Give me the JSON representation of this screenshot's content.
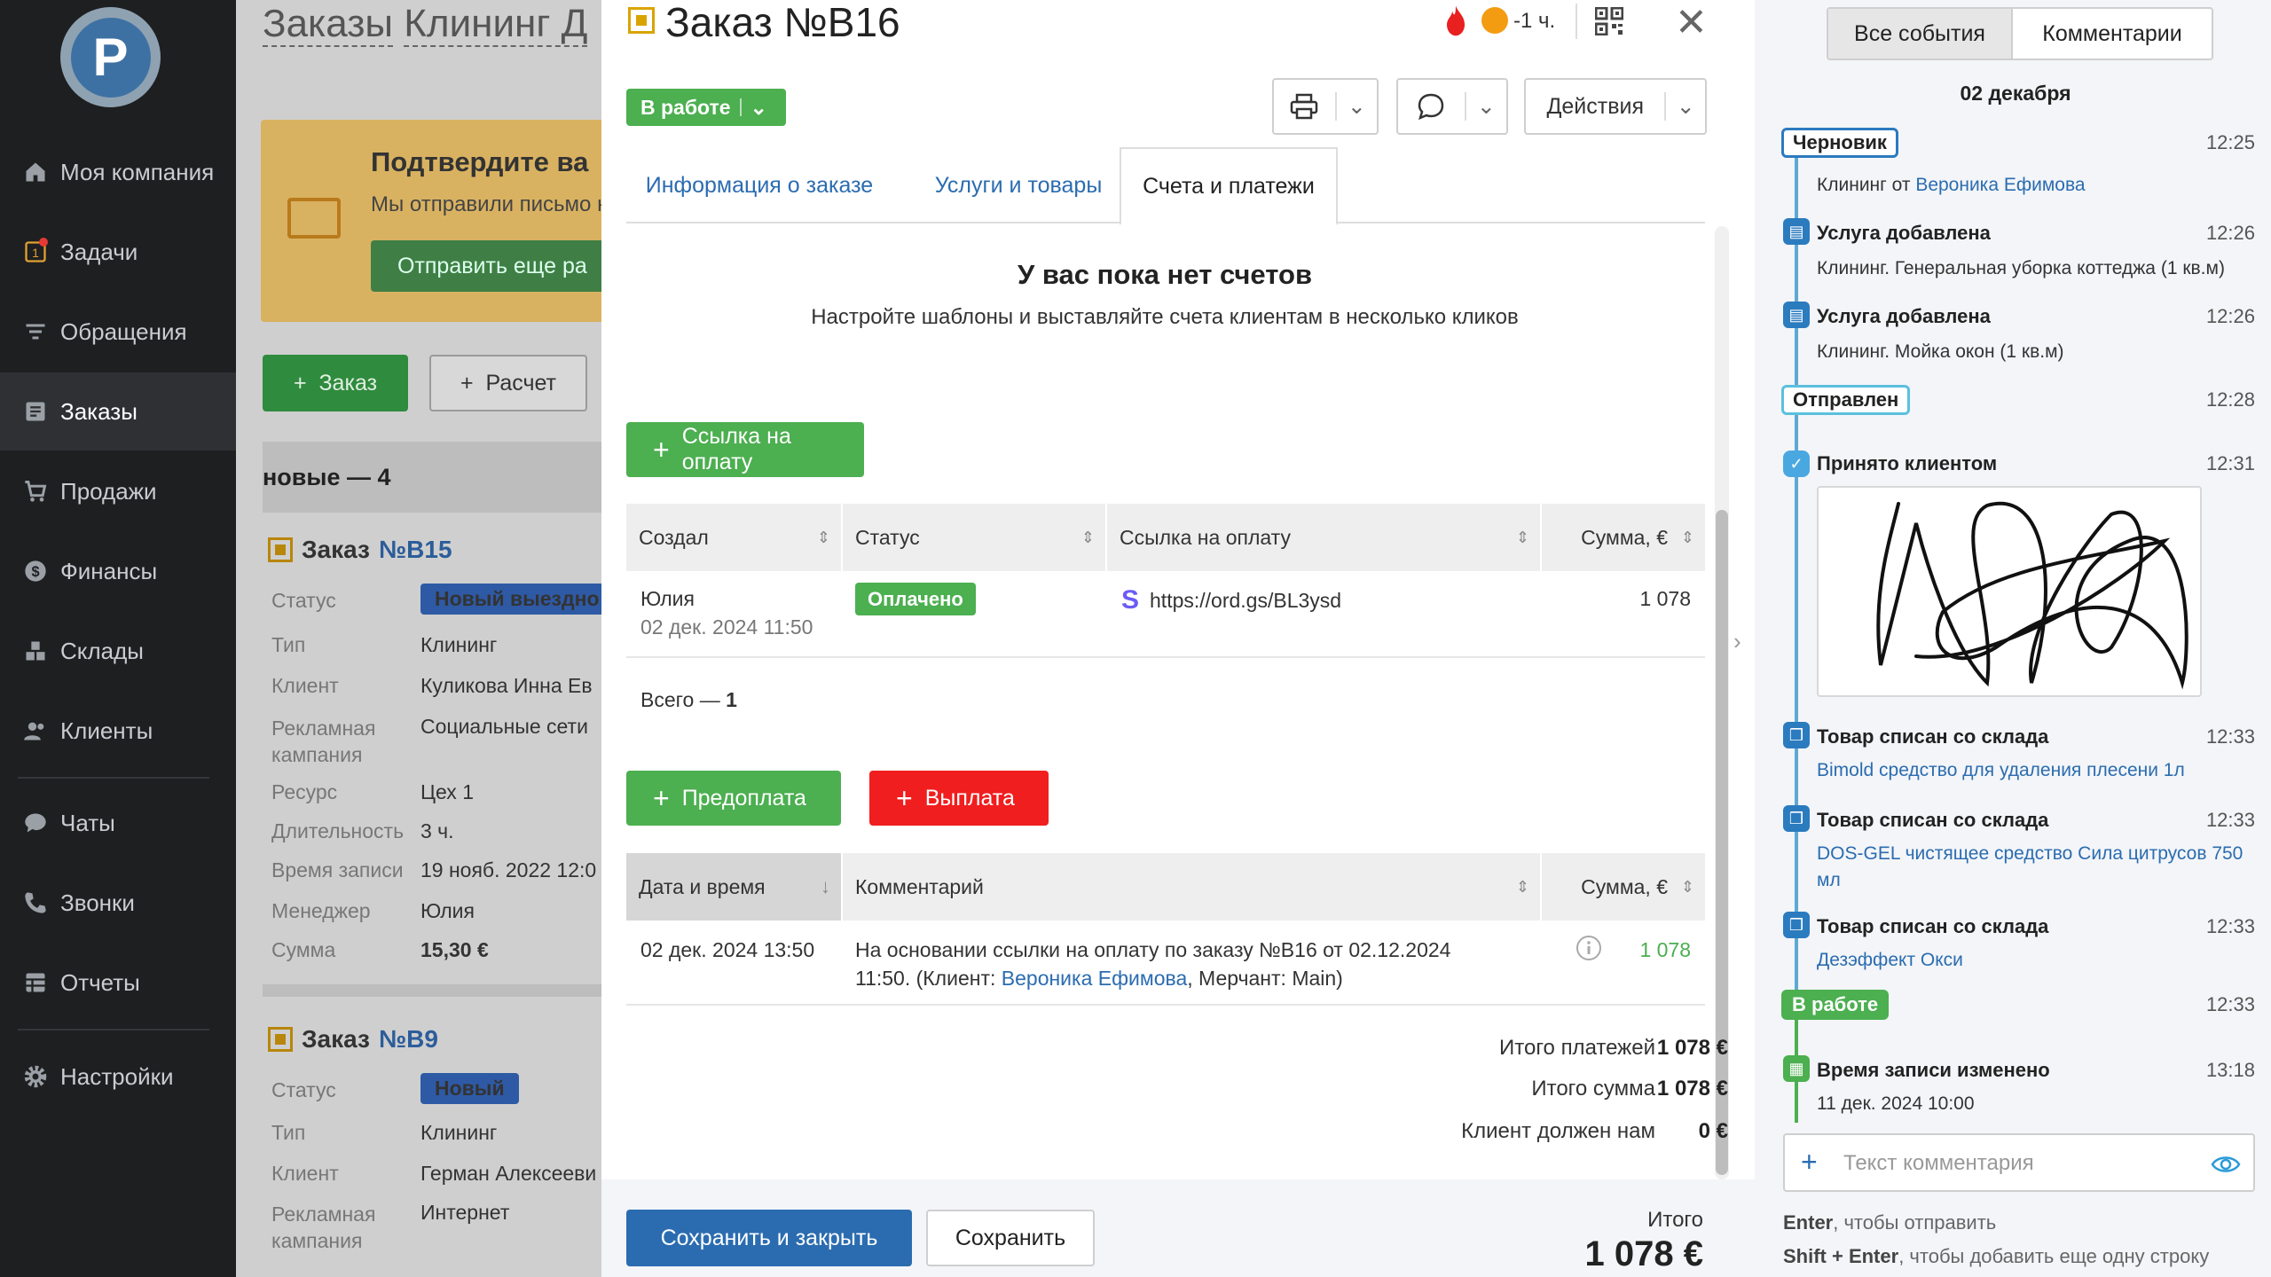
{
  "sidebar": {
    "items": [
      {
        "label": "Моя компания",
        "icon": "home-icon"
      },
      {
        "label": "Задачи",
        "icon": "tasks-icon"
      },
      {
        "label": "Обращения",
        "icon": "filter-icon"
      },
      {
        "label": "Заказы",
        "icon": "orders-icon"
      },
      {
        "label": "Продажи",
        "icon": "cart-icon"
      },
      {
        "label": "Финансы",
        "icon": "dollar-icon"
      },
      {
        "label": "Склады",
        "icon": "warehouse-icon"
      },
      {
        "label": "Клиенты",
        "icon": "clients-icon"
      },
      {
        "label": "Чаты",
        "icon": "chat-icon"
      },
      {
        "label": "Звонки",
        "icon": "phone-icon"
      },
      {
        "label": "Отчеты",
        "icon": "reports-icon"
      },
      {
        "label": "Настройки",
        "icon": "gear-icon"
      }
    ],
    "tasks_badge": "1"
  },
  "background": {
    "title_prefix": "Заказы",
    "title_filter": "Клининг Д",
    "banner_title": "Подтвердите ва",
    "banner_text": "Мы отправили письмо н",
    "banner_button": "Отправить еще ра",
    "add_order": "Заказ",
    "add_calc": "Расчет",
    "group_title": "новые — 4",
    "order1": {
      "title": "Заказ",
      "num": "№B15",
      "rows": [
        {
          "k": "Статус",
          "v": "Новый выездно"
        },
        {
          "k": "Тип",
          "v": "Клининг"
        },
        {
          "k": "Клиент",
          "v": "Куликова Инна Ев"
        },
        {
          "k": "Рекламная кампания",
          "v": "Социальные сети"
        },
        {
          "k": "Ресурс",
          "v": "Цех 1"
        },
        {
          "k": "Длительность",
          "v": "3 ч."
        },
        {
          "k": "Время записи",
          "v": "19 нояб. 2022 12:0"
        },
        {
          "k": "Менеджер",
          "v": "Юлия"
        },
        {
          "k": "Сумма",
          "v": "15,30 €"
        }
      ]
    },
    "order2": {
      "title": "Заказ",
      "num": "№B9",
      "rows": [
        {
          "k": "Статус",
          "v": "Новый"
        },
        {
          "k": "Тип",
          "v": "Клининг"
        },
        {
          "k": "Клиент",
          "v": "Герман Алексееви"
        },
        {
          "k": "Рекламная кампания",
          "v": "Интернет"
        }
      ]
    }
  },
  "modal": {
    "title": "Заказ №B16",
    "time_left": "-1 ч.",
    "status": "В работе",
    "actions": "Действия",
    "tabs": [
      "Информация о заказе",
      "Услуги и товары",
      "Счета и платежи"
    ],
    "empty_title": "У вас пока нет счетов",
    "empty_text": "Настройте шаблоны и выставляйте счета клиентам в несколько кликов",
    "pay_link_button": "Ссылка на оплату",
    "links_table": {
      "headers": [
        "Создал",
        "Статус",
        "Ссылка на оплату",
        "Сумма, €"
      ],
      "row": {
        "creator": "Юлия",
        "created": "02 дек. 2024 11:50",
        "status": "Оплачено",
        "link": "https://ord.gs/BL3ysd",
        "sum": "1 078"
      },
      "total_label": "Всего —",
      "total_count": "1"
    },
    "prepay_button": "Предоплата",
    "payout_button": "Выплата",
    "payments_table": {
      "headers": [
        "Дата и время",
        "Комментарий",
        "Сумма, €"
      ],
      "row": {
        "datetime": "02 дек. 2024 13:50",
        "comment_1": "На основании ссылки на оплату по заказу №B16 от 02.12.2024",
        "comment_2a": "11:50.  (Клиент: ",
        "client": "Вероника Ефимова",
        "comment_2b": ", Мерчант: Main)",
        "sum": "1 078"
      }
    },
    "totals": [
      {
        "label": "Итого платежей",
        "value": "1 078 €"
      },
      {
        "label": "Итого сумма",
        "value": "1 078 €"
      },
      {
        "label": "Клиент должен нам",
        "value": "0 €"
      }
    ],
    "footer": {
      "save_close": "Сохранить и закрыть",
      "save": "Сохранить",
      "total_label": "Итого",
      "total_value": "1 078 €"
    }
  },
  "events_panel": {
    "tabs": [
      "Все события",
      "Комментарии"
    ],
    "date": "02 декабря",
    "events": [
      {
        "type": "pill",
        "title": "Черновик",
        "time": "12:25",
        "desc_prefix": "Клининг от ",
        "desc_link": "Вероника Ефимова"
      },
      {
        "type": "icon",
        "title": "Услуга добавлена",
        "time": "12:26",
        "desc": "Клининг. Генеральная уборка коттеджа (1 кв.м)"
      },
      {
        "type": "icon",
        "title": "Услуга добавлена",
        "time": "12:26",
        "desc": "Клининг. Мойка окон (1 кв.м)"
      },
      {
        "type": "pill",
        "title": "Отправлен",
        "time": "12:28"
      },
      {
        "type": "icon",
        "title": "Принято клиентом",
        "time": "12:31"
      },
      {
        "type": "icon",
        "title": "Товар списан со склада",
        "time": "12:33",
        "desc_link": "Bimold средство для удаления плесени 1л"
      },
      {
        "type": "icon",
        "title": "Товар списан со склада",
        "time": "12:33",
        "desc_link": "DOS-GEL чистящее средство Сила цитрусов 750 мл"
      },
      {
        "type": "icon",
        "title": "Товар списан со склада",
        "time": "12:33",
        "desc_link": "Дезэффект Окси"
      },
      {
        "type": "pill",
        "title": "В работе",
        "time": "12:33"
      },
      {
        "type": "icon",
        "title": "Время записи изменено",
        "time": "13:18",
        "desc": "11 дек. 2024 10:00"
      }
    ],
    "comment_placeholder": "Текст комментария",
    "hint1_key": "Enter",
    "hint1_text": ", чтобы отправить",
    "hint2_key": "Shift + Enter",
    "hint2_text": ", чтобы добавить еще одну строку"
  },
  "colors": {
    "accent_blue": "#2b6cb0",
    "green": "#4caf50",
    "red": "#f01e1e",
    "sidebar": "#1e1f21"
  }
}
